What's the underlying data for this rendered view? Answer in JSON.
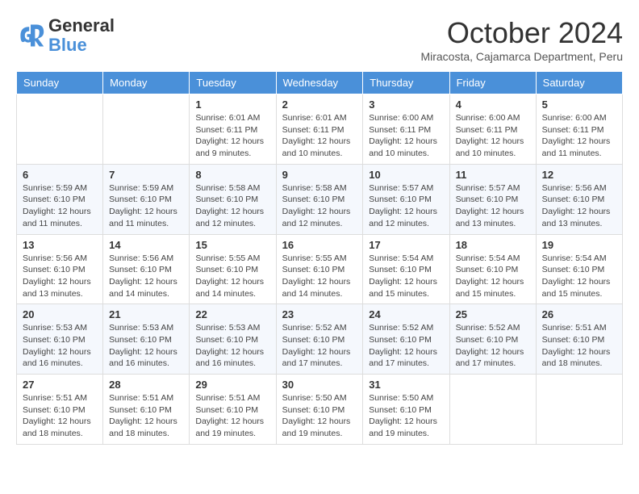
{
  "logo": {
    "line1": "General",
    "line2": "Blue"
  },
  "title": "October 2024",
  "subtitle": "Miracosta, Cajamarca Department, Peru",
  "days_header": [
    "Sunday",
    "Monday",
    "Tuesday",
    "Wednesday",
    "Thursday",
    "Friday",
    "Saturday"
  ],
  "weeks": [
    [
      {
        "day": "",
        "info": ""
      },
      {
        "day": "",
        "info": ""
      },
      {
        "day": "1",
        "info": "Sunrise: 6:01 AM\nSunset: 6:11 PM\nDaylight: 12 hours and 9 minutes."
      },
      {
        "day": "2",
        "info": "Sunrise: 6:01 AM\nSunset: 6:11 PM\nDaylight: 12 hours and 10 minutes."
      },
      {
        "day": "3",
        "info": "Sunrise: 6:00 AM\nSunset: 6:11 PM\nDaylight: 12 hours and 10 minutes."
      },
      {
        "day": "4",
        "info": "Sunrise: 6:00 AM\nSunset: 6:11 PM\nDaylight: 12 hours and 10 minutes."
      },
      {
        "day": "5",
        "info": "Sunrise: 6:00 AM\nSunset: 6:11 PM\nDaylight: 12 hours and 11 minutes."
      }
    ],
    [
      {
        "day": "6",
        "info": "Sunrise: 5:59 AM\nSunset: 6:10 PM\nDaylight: 12 hours and 11 minutes."
      },
      {
        "day": "7",
        "info": "Sunrise: 5:59 AM\nSunset: 6:10 PM\nDaylight: 12 hours and 11 minutes."
      },
      {
        "day": "8",
        "info": "Sunrise: 5:58 AM\nSunset: 6:10 PM\nDaylight: 12 hours and 12 minutes."
      },
      {
        "day": "9",
        "info": "Sunrise: 5:58 AM\nSunset: 6:10 PM\nDaylight: 12 hours and 12 minutes."
      },
      {
        "day": "10",
        "info": "Sunrise: 5:57 AM\nSunset: 6:10 PM\nDaylight: 12 hours and 12 minutes."
      },
      {
        "day": "11",
        "info": "Sunrise: 5:57 AM\nSunset: 6:10 PM\nDaylight: 12 hours and 13 minutes."
      },
      {
        "day": "12",
        "info": "Sunrise: 5:56 AM\nSunset: 6:10 PM\nDaylight: 12 hours and 13 minutes."
      }
    ],
    [
      {
        "day": "13",
        "info": "Sunrise: 5:56 AM\nSunset: 6:10 PM\nDaylight: 12 hours and 13 minutes."
      },
      {
        "day": "14",
        "info": "Sunrise: 5:56 AM\nSunset: 6:10 PM\nDaylight: 12 hours and 14 minutes."
      },
      {
        "day": "15",
        "info": "Sunrise: 5:55 AM\nSunset: 6:10 PM\nDaylight: 12 hours and 14 minutes."
      },
      {
        "day": "16",
        "info": "Sunrise: 5:55 AM\nSunset: 6:10 PM\nDaylight: 12 hours and 14 minutes."
      },
      {
        "day": "17",
        "info": "Sunrise: 5:54 AM\nSunset: 6:10 PM\nDaylight: 12 hours and 15 minutes."
      },
      {
        "day": "18",
        "info": "Sunrise: 5:54 AM\nSunset: 6:10 PM\nDaylight: 12 hours and 15 minutes."
      },
      {
        "day": "19",
        "info": "Sunrise: 5:54 AM\nSunset: 6:10 PM\nDaylight: 12 hours and 15 minutes."
      }
    ],
    [
      {
        "day": "20",
        "info": "Sunrise: 5:53 AM\nSunset: 6:10 PM\nDaylight: 12 hours and 16 minutes."
      },
      {
        "day": "21",
        "info": "Sunrise: 5:53 AM\nSunset: 6:10 PM\nDaylight: 12 hours and 16 minutes."
      },
      {
        "day": "22",
        "info": "Sunrise: 5:53 AM\nSunset: 6:10 PM\nDaylight: 12 hours and 16 minutes."
      },
      {
        "day": "23",
        "info": "Sunrise: 5:52 AM\nSunset: 6:10 PM\nDaylight: 12 hours and 17 minutes."
      },
      {
        "day": "24",
        "info": "Sunrise: 5:52 AM\nSunset: 6:10 PM\nDaylight: 12 hours and 17 minutes."
      },
      {
        "day": "25",
        "info": "Sunrise: 5:52 AM\nSunset: 6:10 PM\nDaylight: 12 hours and 17 minutes."
      },
      {
        "day": "26",
        "info": "Sunrise: 5:51 AM\nSunset: 6:10 PM\nDaylight: 12 hours and 18 minutes."
      }
    ],
    [
      {
        "day": "27",
        "info": "Sunrise: 5:51 AM\nSunset: 6:10 PM\nDaylight: 12 hours and 18 minutes."
      },
      {
        "day": "28",
        "info": "Sunrise: 5:51 AM\nSunset: 6:10 PM\nDaylight: 12 hours and 18 minutes."
      },
      {
        "day": "29",
        "info": "Sunrise: 5:51 AM\nSunset: 6:10 PM\nDaylight: 12 hours and 19 minutes."
      },
      {
        "day": "30",
        "info": "Sunrise: 5:50 AM\nSunset: 6:10 PM\nDaylight: 12 hours and 19 minutes."
      },
      {
        "day": "31",
        "info": "Sunrise: 5:50 AM\nSunset: 6:10 PM\nDaylight: 12 hours and 19 minutes."
      },
      {
        "day": "",
        "info": ""
      },
      {
        "day": "",
        "info": ""
      }
    ]
  ]
}
